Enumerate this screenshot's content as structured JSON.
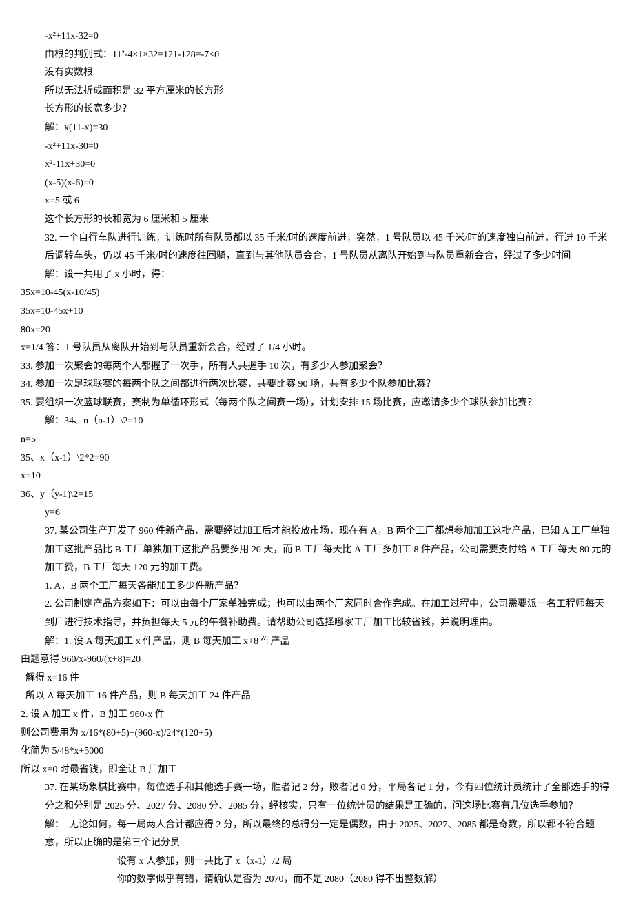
{
  "lines": [
    {
      "cls": "indent1",
      "text": "-x²+11x-32=0"
    },
    {
      "cls": "indent1",
      "text": "由根的判别式：11²-4×1×32=121-128=-7<0"
    },
    {
      "cls": "indent1",
      "text": "没有实数根"
    },
    {
      "cls": "indent1",
      "text": "所以无法折成面积是 32 平方厘米的长方形"
    },
    {
      "cls": "indent1",
      "text": "长方形的长宽多少？"
    },
    {
      "cls": "indent1",
      "text": "解：x(11-x)=30"
    },
    {
      "cls": "indent1",
      "text": "-x²+11x-30=0"
    },
    {
      "cls": "indent1",
      "text": "x²-11x+30=0"
    },
    {
      "cls": "indent1",
      "text": "(x-5)(x-6)=0"
    },
    {
      "cls": "indent1",
      "text": "x=5 或 6"
    },
    {
      "cls": "indent1",
      "text": "这个长方形的长和宽为 6 厘米和 5 厘米"
    },
    {
      "cls": "indent1",
      "text": "32. 一个自行车队进行训练，训练时所有队员都以 35 千米/时的速度前进，突然，1 号队员以 45 千米/时的速度独自前进，行进 10 千米后调转车头，仍以 45 千米/时的速度往回骑，直到与其他队员会合，1 号队员从离队开始到与队员重新会合，经过了多少时间"
    },
    {
      "cls": "indent1",
      "text": "解：设一共用了 x 小时，得："
    },
    {
      "cls": "",
      "text": "35x=10-45(x-10/45)"
    },
    {
      "cls": "",
      "text": "35x=10-45x+10"
    },
    {
      "cls": "",
      "text": "80x=20"
    },
    {
      "cls": "",
      "text": "x=1/4 答：1 号队员从离队开始到与队员重新会合，经过了 1/4 小时。"
    },
    {
      "cls": "",
      "text": "33. 参加一次聚会的每两个人都握了一次手，所有人共握手 10 次，有多少人参加聚会？"
    },
    {
      "cls": "",
      "text": "34. 参加一次足球联赛的每两个队之间都进行两次比赛，共要比赛 90 场，共有多少个队参加比赛？"
    },
    {
      "cls": "",
      "text": "35. 要组织一次篮球联赛，赛制为单循环形式（每两个队之间赛一场），计划安排 15 场比赛，应邀请多少个球队参加比赛？"
    },
    {
      "cls": "indent1",
      "text": "解：34、n（n-1）\\2=10"
    },
    {
      "cls": "",
      "text": "n=5"
    },
    {
      "cls": "",
      "text": "35、x（x-1）\\2*2=90"
    },
    {
      "cls": "",
      "text": "x=10"
    },
    {
      "cls": "",
      "text": "36、y（y-1)\\2=15"
    },
    {
      "cls": "indent1",
      "text": "y=6"
    },
    {
      "cls": "indent1",
      "text": "37. 某公司生产开发了 960 件新产品，需要经过加工后才能投放市场，现在有 A，B 两个工厂都想参加加工这批产品，已知 A 工厂单独加工这批产品比 B 工厂单独加工这批产品要多用 20 天，而 B 工厂每天比 A 工厂多加工 8 件产品，公司需要支付给 A 工厂每天 80 元的加工费，B 工厂每天 120 元的加工费。"
    },
    {
      "cls": "indent1",
      "text": "1. A，B 两个工厂每天各能加工多少件新产品？"
    },
    {
      "cls": "indent1",
      "text": "2. 公司制定产品方案如下：可以由每个厂家单独完成；也可以由两个厂家同时合作完成。在加工过程中，公司需要派一名工程师每天到厂进行技术指导，并负担每天 5 元的午餐补助费。请帮助公司选择哪家工厂加工比较省钱，并说明理由。"
    },
    {
      "cls": "indent1",
      "text": "解：1. 设 A 每天加工 x 件产品，则 B 每天加工 x+8 件产品"
    },
    {
      "cls": "",
      "text": "由题意得 960/x-960/(x+8)=20"
    },
    {
      "cls": "",
      "text": "  解得 x=16 件"
    },
    {
      "cls": "",
      "text": "  所以 A 每天加工 16 件产品，则 B 每天加工 24 件产品"
    },
    {
      "cls": "",
      "text": "2. 设 A 加工 x 件，B 加工 960-x 件"
    },
    {
      "cls": "",
      "text": "则公司费用为 x/16*(80+5)+(960-x)/24*(120+5)"
    },
    {
      "cls": "",
      "text": "化简为 5/48*x+5000"
    },
    {
      "cls": "",
      "text": "所以 x=0 时最省钱，即全让 B 厂加工"
    },
    {
      "cls": "indent1",
      "text": "37. 在某场象棋比赛中，每位选手和其他选手赛一场，胜者记 2 分，败者记 0 分，平局各记 1 分，今有四位统计员统计了全部选手的得分之和分别是 2025 分、2027 分、2080 分、2085 分，经核实，只有一位统计员的结果是正确的，问这场比赛有几位选手参加？"
    },
    {
      "cls": "indent1",
      "text": "解：  无论如何，每一局两人合计都应得 2 分，所以最终的总得分一定是偶数，由于 2025、2027、2085 都是奇数，所以都不符合题意，所以正确的是第三个记分员"
    },
    {
      "cls": "indent2",
      "text": "设有 x 人参加，则一共比了 x（x-1）/2 局"
    },
    {
      "cls": "indent2",
      "text": "你的数字似乎有错，请确认是否为 2070，而不是 2080（2080 得不出整数解）"
    }
  ]
}
